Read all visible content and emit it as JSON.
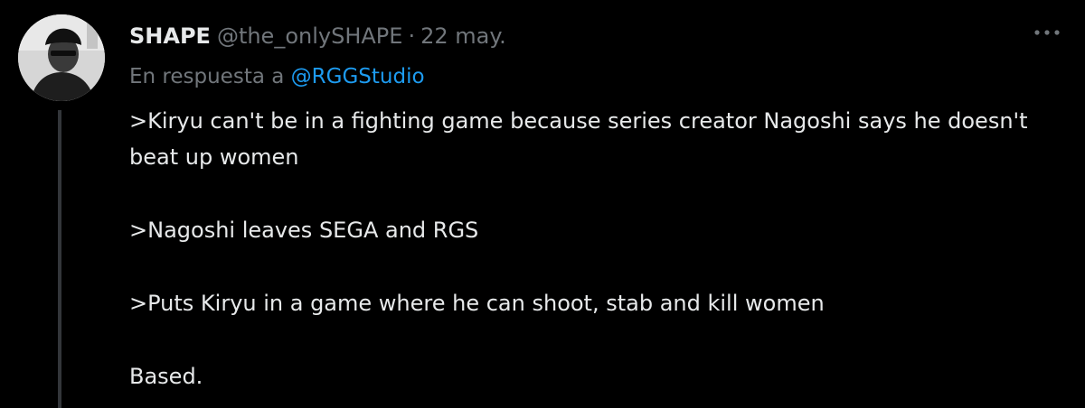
{
  "tweet": {
    "display_name": "SHAPE",
    "handle": "@the_onlySHAPE",
    "separator": "·",
    "date": "22 may.",
    "reply_prefix": "En respuesta a",
    "reply_to": "@RGGStudio",
    "paragraphs": [
      ">Kiryu can't be in a fighting game because series creator Nagoshi says he doesn't beat up women",
      ">Nagoshi leaves SEGA and RGS",
      ">Puts Kiryu in a game where he can shoot, stab and kill women",
      "Based."
    ],
    "avatar_icon": "user-avatar-photo",
    "more_icon": "more-horizontal-icon"
  },
  "colors": {
    "background": "#000000",
    "primary_text": "#e7e9ea",
    "secondary_text": "#71767b",
    "link": "#1d9bf0",
    "thread_line": "#33363a"
  }
}
